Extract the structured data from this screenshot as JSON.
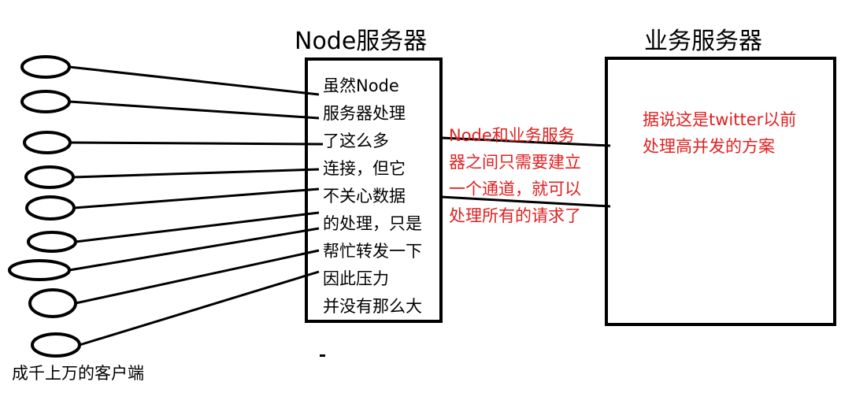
{
  "node_server": {
    "title": "Node服务器",
    "lines": [
      "虽然Node",
      "服务器处理",
      "了这么多",
      "连接，但它",
      "不关心数据",
      "的处理，只是",
      "帮忙转发一下",
      "因此压力",
      "并没有那么大"
    ]
  },
  "business_server": {
    "title": "业务服务器",
    "note_lines": [
      "据说这是twitter以前",
      "处理高并发的方案"
    ]
  },
  "channel_note": {
    "lines": [
      "Node和业务服务",
      "器之间只需要建立",
      "一个通道，就可以",
      "处理所有的请求了"
    ]
  },
  "clients": {
    "caption": "成千上万的客户端",
    "count": 9
  },
  "colors": {
    "note": "#e02020",
    "stroke": "#000000"
  }
}
